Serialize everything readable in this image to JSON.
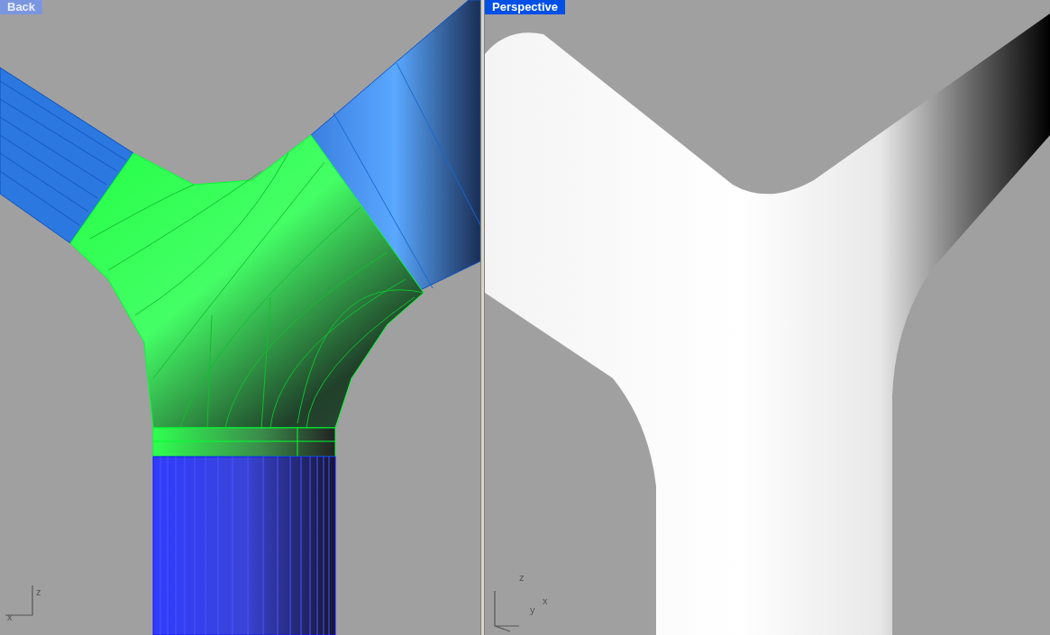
{
  "viewports": [
    {
      "title": "Back",
      "selected": false,
      "axes": [
        {
          "kind": "z",
          "label": "z"
        },
        {
          "kind": "x",
          "label": "x"
        }
      ]
    },
    {
      "title": "Perspective",
      "selected": true,
      "axes": [
        {
          "kind": "z",
          "label": "z"
        },
        {
          "kind": "x",
          "label": "x"
        },
        {
          "kind": "y",
          "label": "y"
        }
      ]
    }
  ]
}
